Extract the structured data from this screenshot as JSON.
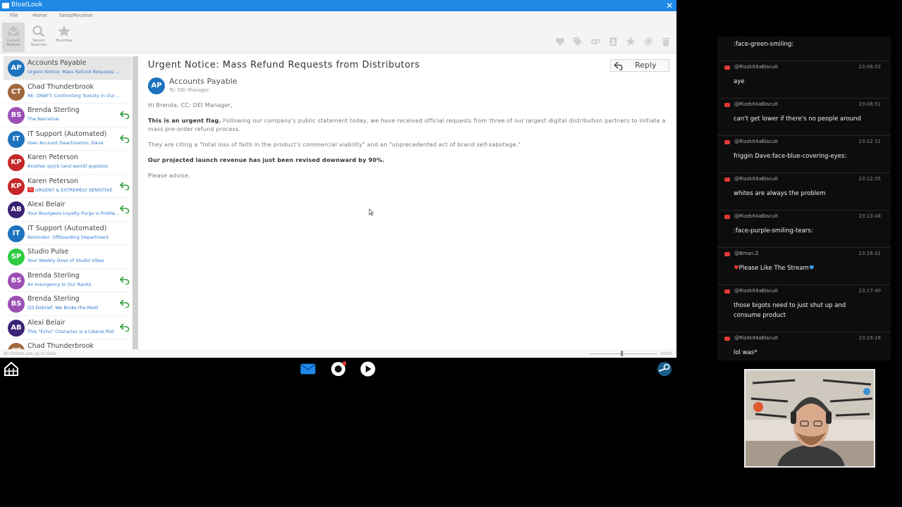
{
  "app": {
    "title": "BloatLook",
    "menu": [
      "File",
      "Home",
      "Send/Receive"
    ],
    "ribbon": [
      {
        "label": "Current Mailbox"
      },
      {
        "label": "Recent Searches"
      },
      {
        "label": "Favorites"
      }
    ],
    "ribbon_right_icons": [
      "heart-icon",
      "tag-icon",
      "link-icon",
      "contact-icon",
      "star-icon",
      "gear-icon",
      "trash-icon"
    ]
  },
  "emails": [
    {
      "initials": "AP",
      "color": "#1e73be",
      "sender": "Accounts Payable",
      "subject": "Urgent Notice: Mass Refund Requests from Distributors",
      "replied": false,
      "selected": true
    },
    {
      "initials": "CT",
      "color": "#a1673d",
      "sender": "Chad Thunderbrook",
      "subject": "RE: DRAFT: Confronting Toxicity in Our Community",
      "replied": false
    },
    {
      "initials": "BS",
      "color": "#9c4fb5",
      "sender": "Brenda Sterling",
      "subject": "The Narrative.",
      "replied": true
    },
    {
      "initials": "IT",
      "color": "#1e73be",
      "sender": "IT Support (Automated)",
      "subject": "User Account Deactivation: Dave",
      "replied": true
    },
    {
      "initials": "KP",
      "color": "#c62828",
      "sender": "Karen Peterson",
      "subject": "Another quick (and weird) question",
      "replied": false
    },
    {
      "initials": "KP",
      "color": "#c62828",
      "sender": "Karen Peterson",
      "subject": "URGENT & EXTREMELY SENSITIVE",
      "replied": true,
      "flag": "!!!"
    },
    {
      "initials": "AB",
      "color": "#3a2275",
      "sender": "Alexi Belair",
      "subject": "Your Bourgeois Loyalty Purge is Problematic",
      "replied": true
    },
    {
      "initials": "IT",
      "color": "#1e73be",
      "sender": "IT Support (Automated)",
      "subject": "Reminder: Offboarding Department",
      "replied": false
    },
    {
      "initials": "SP",
      "color": "#2ecc40",
      "sender": "Studio Pulse",
      "subject": "Your Weekly Dose of Studio Vibes",
      "replied": false
    },
    {
      "initials": "BS",
      "color": "#9c4fb5",
      "sender": "Brenda Sterling",
      "subject": "An Insurgency In Our Ranks",
      "replied": true
    },
    {
      "initials": "BS",
      "color": "#9c4fb5",
      "sender": "Brenda Sterling",
      "subject": "Q3 Debrief: We Broke the Mold",
      "replied": true
    },
    {
      "initials": "AB",
      "color": "#3a2275",
      "sender": "Alexi Belair",
      "subject": "This \"Echo\" Character is a Liberal Plot",
      "replied": true
    },
    {
      "initials": "CT",
      "color": "#a1673d",
      "sender": "Chad Thunderbrook",
      "subject": "",
      "replied": false
    }
  ],
  "reader": {
    "subject": "Urgent Notice: Mass Refund Requests from Distributors",
    "reply_label": "Reply",
    "sender_initials": "AP",
    "sender": "Accounts Payable",
    "to": "To:  DEI Manager",
    "greeting": "Hi Brenda, CC: DEI Manager,",
    "p1_strong": "This is an urgent flag.",
    "p1_rest": " Following our company's public statement today, we have received official requests from three of our largest digital distribution partners to initiate a mass pre-order refund process.",
    "p2": "They are citing a \"total loss of faith in the product's commercial viability\" and an \"unprecedented act of brand self-sabotage.\"",
    "p3": "Our projected launch revenue has just been revised downward by 90%.",
    "p4": "Please advise."
  },
  "status": {
    "text": "All folders are up to date",
    "zoom": "100%",
    "zoom_level": 0.5
  },
  "chat": [
    {
      "user": "",
      "time": "",
      "text": ":face-green-smiling:"
    },
    {
      "user": "@Rizzkit4aBiscuit",
      "time": "23:06:53",
      "text": "aye"
    },
    {
      "user": "@Rizzkit4aBiscuit",
      "time": "23:08:51",
      "text": "can't get lower if there's no people around"
    },
    {
      "user": "@Rizzkit4aBiscuit",
      "time": "23:12:11",
      "text": "friggin Dave:face-blue-covering-eyes:"
    },
    {
      "user": "@Rizzkit4aBiscuit",
      "time": "23:12:35",
      "text": "whites are always the problem"
    },
    {
      "user": "@Rizzkit4aBiscuit",
      "time": "23:13:48",
      "text": ":face-purple-smiling-tears:"
    },
    {
      "user": "@Bman.Z",
      "time": "23:16:31",
      "text": "Please Like The Stream"
    },
    {
      "user": "@Rizzkit4aBiscuit",
      "time": "23:17:40",
      "text": "those bigots need to just shut up and consume product"
    },
    {
      "user": "@Rizzkit4aBiscuit",
      "time": "23:19:18",
      "text": "lol was*"
    }
  ]
}
